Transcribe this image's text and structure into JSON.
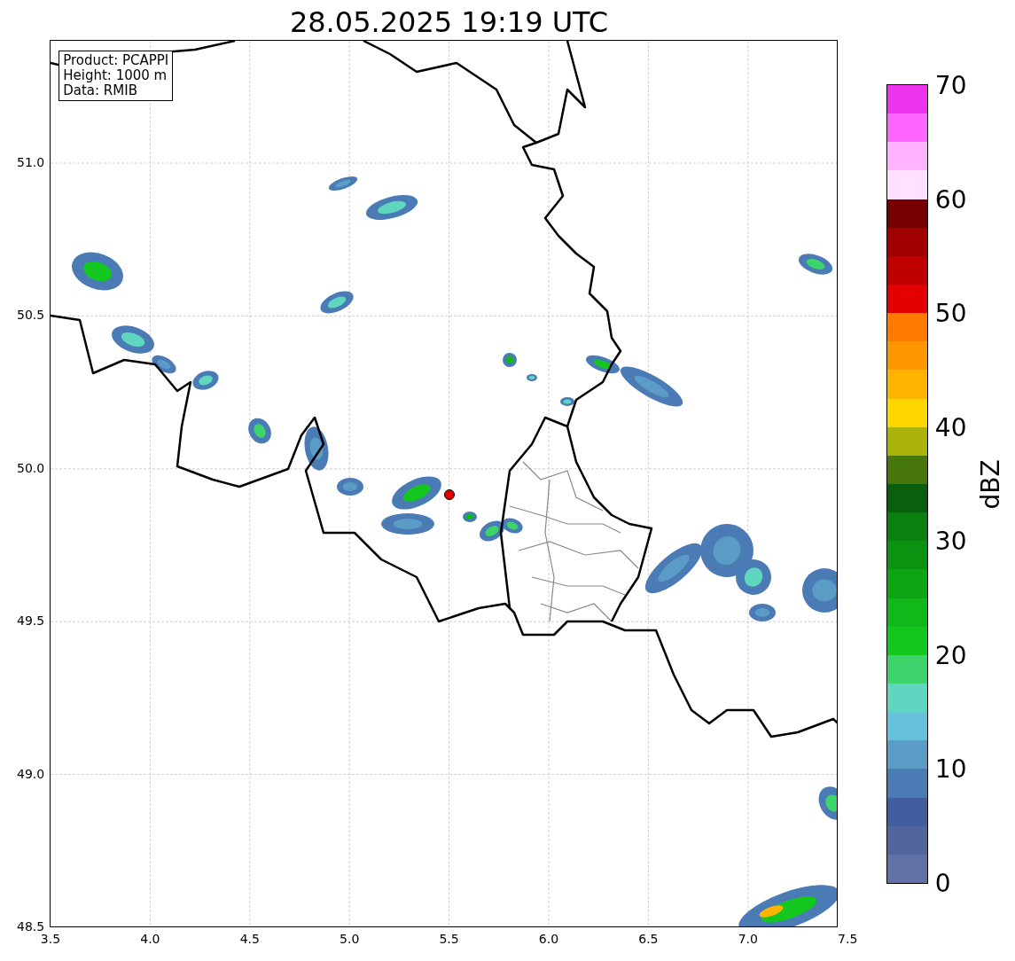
{
  "title": "28.05.2025 19:19 UTC",
  "info_box": [
    "Product: PCAPPI",
    "Height: 1000 m",
    "Data: RMIB"
  ],
  "y_ticks": [
    "51.0",
    "50.5",
    "50.0",
    "49.5",
    "49.0",
    "48.5"
  ],
  "x_ticks": [
    "3.5",
    "4.0",
    "4.5",
    "5.0",
    "5.5",
    "6.0",
    "6.5",
    "7.0",
    "7.5"
  ],
  "colorbar": {
    "label": "dBZ",
    "ticks": [
      "70",
      "60",
      "50",
      "40",
      "30",
      "20",
      "10",
      "0"
    ],
    "bands": [
      {
        "color": "#6171a6"
      },
      {
        "color": "#52669e"
      },
      {
        "color": "#425ea0"
      },
      {
        "color": "#4a7bb5"
      },
      {
        "color": "#5a9cc6"
      },
      {
        "color": "#66c1dd"
      },
      {
        "color": "#5fd6c0"
      },
      {
        "color": "#3dd46c"
      },
      {
        "color": "#14c71e"
      },
      {
        "color": "#10b81a"
      },
      {
        "color": "#0ea514"
      },
      {
        "color": "#0c9211"
      },
      {
        "color": "#0b7f10"
      },
      {
        "color": "#095f0d"
      },
      {
        "color": "#47760a"
      },
      {
        "color": "#aab30a"
      },
      {
        "color": "#ffd600"
      },
      {
        "color": "#ffb400"
      },
      {
        "color": "#ff9800"
      },
      {
        "color": "#ff7a00"
      },
      {
        "color": "#e30000"
      },
      {
        "color": "#c00000"
      },
      {
        "color": "#a00000"
      },
      {
        "color": "#760000"
      },
      {
        "color": "#ffe0ff"
      },
      {
        "color": "#ffb3ff"
      },
      {
        "color": "#ff66ff"
      },
      {
        "color": "#ee33ee"
      }
    ]
  }
}
